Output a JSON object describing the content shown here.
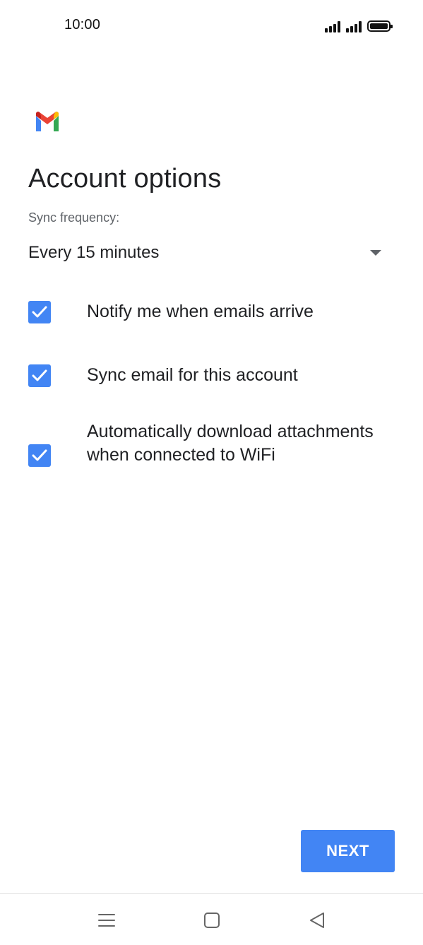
{
  "status_bar": {
    "time": "10:00",
    "icons": [
      "signal-icon",
      "signal-icon",
      "battery-icon"
    ]
  },
  "app": {
    "logo": "gmail-logo-icon"
  },
  "page": {
    "title": "Account options"
  },
  "sync": {
    "label": "Sync frequency:",
    "selected_value": "Every 15 minutes",
    "icon": "dropdown-arrow-icon"
  },
  "options": [
    {
      "label": "Notify me when emails arrive",
      "checked": true
    },
    {
      "label": "Sync email for this account",
      "checked": true
    },
    {
      "label": "Automatically download attachments when connected to WiFi",
      "checked": true
    }
  ],
  "actions": {
    "next_label": "NEXT"
  },
  "nav_bar": {
    "icons": [
      "menu-icon",
      "home-icon",
      "back-icon"
    ]
  },
  "colors": {
    "accent": "#4285f4",
    "text_primary": "#202124",
    "text_secondary": "#5f6368"
  }
}
